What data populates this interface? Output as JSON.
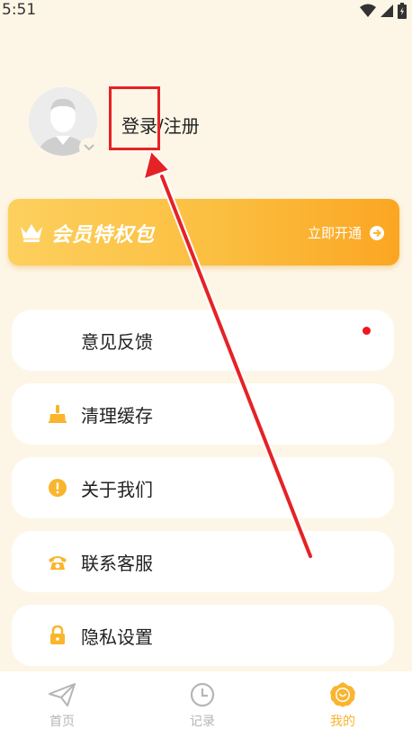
{
  "status_bar": {
    "time": "5:51"
  },
  "profile": {
    "login_label": "登录/注册"
  },
  "vip": {
    "title": "会员特权包",
    "action_label": "立即开通"
  },
  "menu": [
    {
      "label": "意见反馈",
      "icon": "feedback-icon",
      "has_dot": true
    },
    {
      "label": "清理缓存",
      "icon": "broom-icon"
    },
    {
      "label": "关于我们",
      "icon": "info-icon"
    },
    {
      "label": "联系客服",
      "icon": "phone-icon"
    },
    {
      "label": "隐私设置",
      "icon": "lock-icon"
    }
  ],
  "tabs": [
    {
      "label": "首页",
      "icon": "paper-plane-icon",
      "active": false
    },
    {
      "label": "记录",
      "icon": "clock-icon",
      "active": false
    },
    {
      "label": "我的",
      "icon": "smile-flower-icon",
      "active": true
    }
  ],
  "colors": {
    "accent": "#f9b52e",
    "background": "#fdf6e6",
    "annotation": "#e52226"
  }
}
